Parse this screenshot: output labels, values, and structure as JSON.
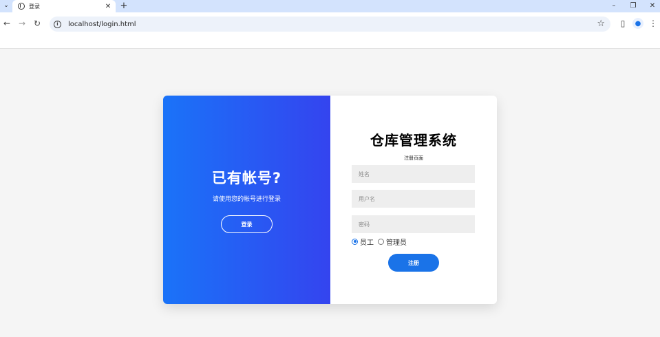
{
  "browser": {
    "tab": {
      "title": "登录",
      "close": "✕"
    },
    "new_tab": "+",
    "tab_menu": "⌄",
    "window": {
      "minimize": "–",
      "restore": "❐",
      "close": "✕"
    },
    "nav": {
      "back": "←",
      "forward": "→",
      "reload": "↻"
    },
    "url": "localhost/login.html",
    "icons": {
      "info": "i",
      "star": "☆",
      "sidepanel": "▯",
      "profile": "●",
      "menu": "⋮"
    }
  },
  "left_panel": {
    "title": "已有帐号?",
    "subtitle": "请使用您的帐号进行登录",
    "login_button": "登录"
  },
  "right_panel": {
    "title": "仓库管理系统",
    "subtitle": "注册页面",
    "fields": {
      "name_placeholder": "姓名",
      "username_placeholder": "用户名",
      "password_placeholder": "密码"
    },
    "roles": [
      {
        "label": "员工",
        "checked": true
      },
      {
        "label": "管理员",
        "checked": false
      }
    ],
    "register_button": "注册"
  },
  "colors": {
    "gradient_start": "#1a73f8",
    "gradient_end": "#3444ef",
    "accent": "#1a73e8",
    "page_bg": "#f5f5f5",
    "field_bg": "#eeeeee"
  }
}
